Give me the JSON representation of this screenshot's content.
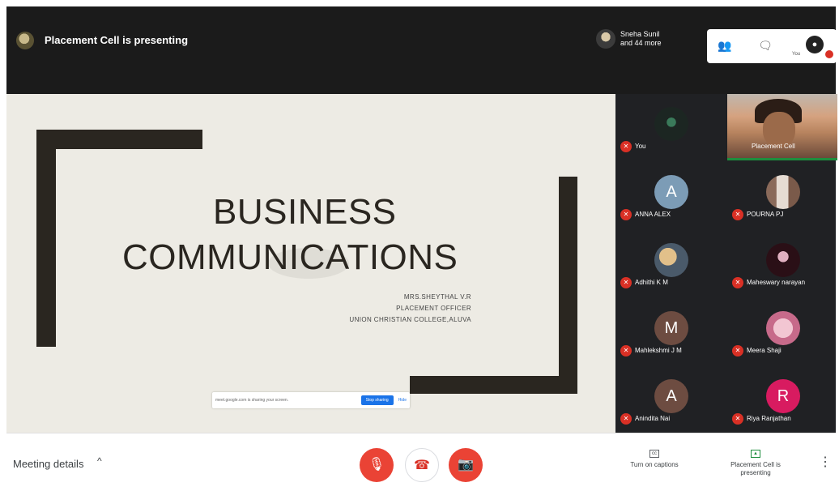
{
  "header": {
    "presenting_title": "Placement Cell is presenting",
    "participants_line1": "Sneha Sunil",
    "participants_line2": "and 44 more",
    "you_label": "You"
  },
  "slide": {
    "title_line1": "BUSINESS",
    "title_line2": "COMMUNICATIONS",
    "subtitle_line1": "MRS.SHEYTHAL V.R",
    "subtitle_line2": "PLACEMENT OFFICER",
    "subtitle_line3": "UNION CHRISTIAN COLLEGE,ALUVA",
    "share_notice": "meet.google.com is sharing your screen.",
    "stop_sharing": "Stop sharing",
    "hide": "Hide"
  },
  "participants": [
    {
      "name": "You",
      "initial": "",
      "color": "#2d3a35"
    },
    {
      "name": "Placement Cell",
      "initial": "",
      "color": "#3a3530"
    },
    {
      "name": "ANNA ALEX",
      "initial": "A",
      "color": "#7c9cb6"
    },
    {
      "name": "POURNA PJ",
      "initial": "",
      "color": "#c7b2a4"
    },
    {
      "name": "Adhithi K M",
      "initial": "",
      "color": "#7a6a55"
    },
    {
      "name": "Maheswary narayan",
      "initial": "",
      "color": "#3a1a22"
    },
    {
      "name": "Mahlekshmi J M",
      "initial": "M",
      "color": "#6d4c41"
    },
    {
      "name": "Meera Shaji",
      "initial": "",
      "color": "#d6b7c0"
    },
    {
      "name": "Anindita Nai",
      "initial": "A",
      "color": "#6d4c41"
    },
    {
      "name": "Riya Ranjathan",
      "initial": "R",
      "color": "#d81b60"
    }
  ],
  "bottom": {
    "meeting_details": "Meeting details",
    "captions": "Turn on captions",
    "presenting": "Placement Cell is presenting"
  }
}
